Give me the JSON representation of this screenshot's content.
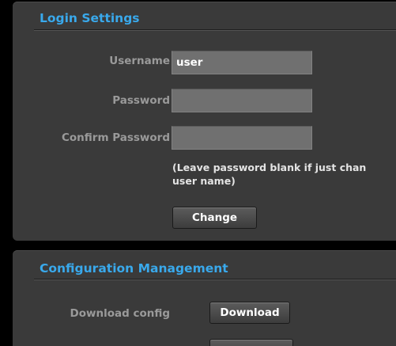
{
  "login_settings": {
    "title": "Login Settings",
    "username_label": "Username",
    "username_value": "user",
    "password_label": "Password",
    "confirm_password_label": "Confirm Password",
    "hint_line1": "(Leave password blank if just chan",
    "hint_line2": "user name)",
    "change_label": "Change"
  },
  "configuration_management": {
    "title": "Configuration Management",
    "download_config_label": "Download config",
    "download_label": "Download"
  },
  "colors": {
    "accent": "#39a9ec",
    "panel": "#3a3a3a",
    "input": "#707070",
    "label": "#9a9a9a"
  }
}
